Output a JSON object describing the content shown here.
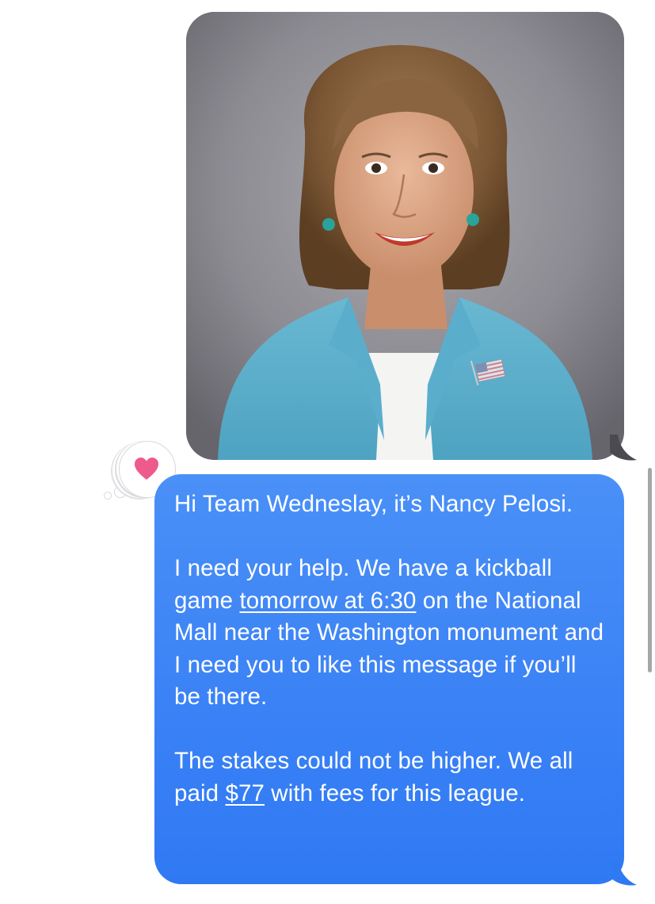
{
  "photo_message": {
    "description_icon": "photo-attachment"
  },
  "tapback": {
    "icon": "heart-icon",
    "color": "#ee5a8c"
  },
  "message": {
    "para1": "Hi Team Wedneslay, it’s Nancy Pelosi.",
    "para2_before": "I need your help. We have a kickball game ",
    "para2_link": "tomorrow at 6:30",
    "para2_after": " on the National Mall near the Washington monument and I need you to like this message if you’ll be there.",
    "para3_before": "The stakes could not be higher. We all paid ",
    "para3_link": "$77",
    "para3_after": " with fees for this league.",
    "bubble_color": "#3b82f6"
  },
  "colors": {
    "background": "#ffffff",
    "bubble_blue": "#3b82f6",
    "text": "#ffffff"
  }
}
